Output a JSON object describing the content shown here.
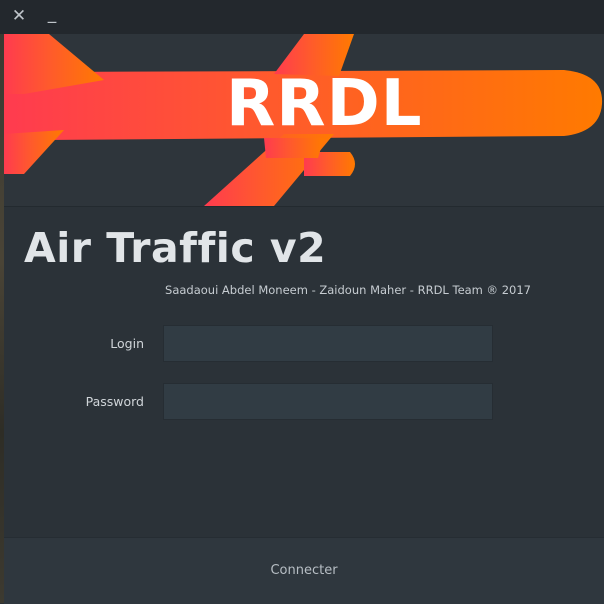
{
  "titlebar": {
    "close_icon": "close-icon",
    "close_glyph": "✕",
    "minimize_icon": "minimize-icon",
    "minimize_glyph": "_"
  },
  "banner": {
    "logo_text": "RRDL",
    "logo_gradient": [
      "#ff3b4f",
      "#ff5a2c",
      "#ff7a00"
    ]
  },
  "app": {
    "title": "Air Traffic v2",
    "credits": "Saadaoui Abdel Moneem - Zaidoun Maher - RRDL Team ® 2017"
  },
  "form": {
    "login_label": "Login",
    "login_value": "",
    "password_label": "Password",
    "password_value": "",
    "submit_label": "Connecter"
  },
  "colors": {
    "background": "#2b3238",
    "titlebar": "#23282d",
    "input_bg": "#313c44",
    "text": "#e1e5e8"
  }
}
